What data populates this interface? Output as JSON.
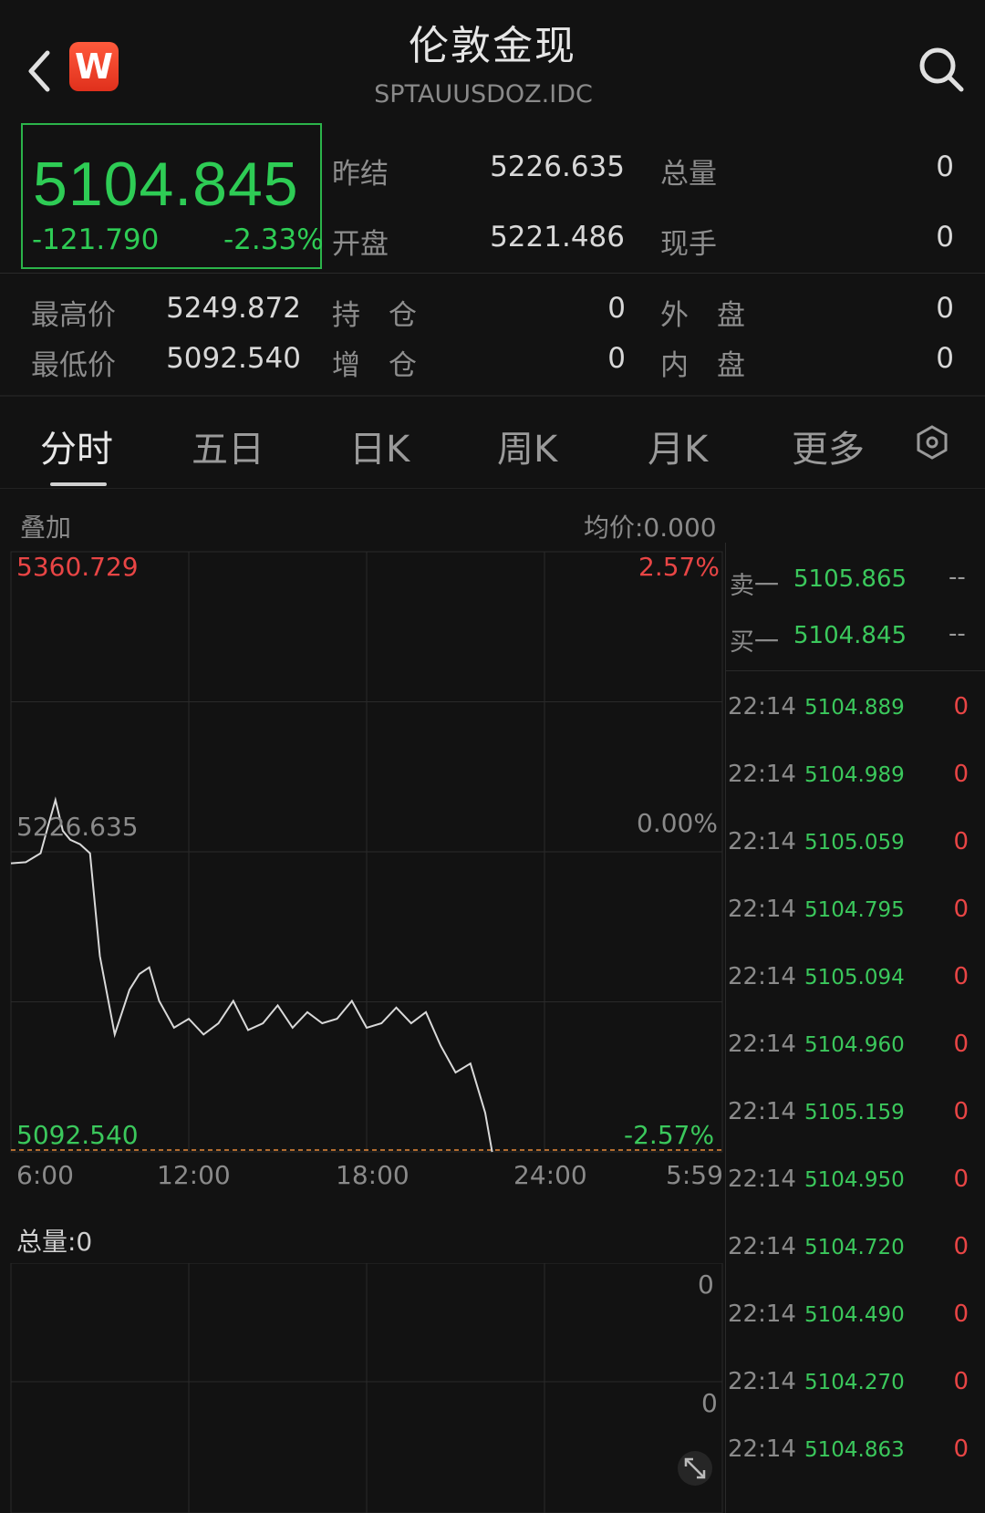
{
  "header": {
    "title": "伦敦金现",
    "symbol": "SPTAUUSDOZ.IDC",
    "logo_letter": "W"
  },
  "quote": {
    "price": "5104.845",
    "change": "-121.790",
    "change_pct": "-2.33%",
    "stats": [
      {
        "label": "昨结",
        "value": "5226.635"
      },
      {
        "label": "总量",
        "value": "0"
      },
      {
        "label": "开盘",
        "value": "5221.486"
      },
      {
        "label": "现手",
        "value": "0"
      },
      {
        "label": "最高价",
        "value": "5249.872"
      },
      {
        "label": "持　仓",
        "value": "0"
      },
      {
        "label": "外　盘",
        "value": "0"
      },
      {
        "label": "最低价",
        "value": "5092.540"
      },
      {
        "label": "增　仓",
        "value": "0"
      },
      {
        "label": "内　盘",
        "value": "0"
      }
    ]
  },
  "tabs": [
    "分时",
    "五日",
    "日K",
    "周K",
    "月K",
    "更多"
  ],
  "active_tab": "分时",
  "chart": {
    "overlay_label": "叠加",
    "avg_price_label": "均价:0.000",
    "y_top": "5360.729",
    "y_mid": "5226.635",
    "y_bottom": "5092.540",
    "pct_top": "2.57%",
    "pct_mid": "0.00%",
    "pct_bottom": "-2.57%",
    "x_labels": [
      "6:00",
      "12:00",
      "18:00",
      "24:00",
      "5:59"
    ],
    "volume_label": "总量:0",
    "volume_ticks": [
      "0",
      "0"
    ],
    "colors": {
      "up": "#e84545",
      "down": "#3bc85c",
      "line": "#d9d9d9",
      "prev_close_line": "#e88a3a"
    }
  },
  "chart_data": {
    "type": "line",
    "title": "",
    "x": [
      "6:00",
      "6:30",
      "7:00",
      "7:15",
      "7:30",
      "7:45",
      "8:00",
      "8:20",
      "8:40",
      "9:00",
      "9:30",
      "10:00",
      "10:20",
      "10:40",
      "11:00",
      "11:30",
      "12:00",
      "12:30",
      "13:00",
      "13:30",
      "14:00",
      "14:30",
      "15:00",
      "15:30",
      "16:00",
      "16:30",
      "17:00",
      "17:30",
      "18:00",
      "18:30",
      "19:00",
      "19:30",
      "20:00",
      "20:30",
      "21:00",
      "21:30",
      "22:00",
      "22:14"
    ],
    "y": [
      5221.5,
      5222.0,
      5226.0,
      5238.0,
      5249.8,
      5236.0,
      5232.0,
      5230.0,
      5226.0,
      5180.0,
      5145.0,
      5165.0,
      5172.0,
      5175.0,
      5160.0,
      5148.0,
      5152.0,
      5145.0,
      5150.0,
      5160.0,
      5147.0,
      5150.0,
      5158.0,
      5148.0,
      5155.0,
      5150.0,
      5152.0,
      5160.0,
      5148.0,
      5150.0,
      5157.0,
      5150.0,
      5155.0,
      5140.0,
      5128.0,
      5132.0,
      5110.0,
      5092.5
    ],
    "ylim": [
      5092.54,
      5360.729
    ],
    "reference": 5226.635,
    "xlabel": "",
    "ylabel": "",
    "grid": true
  },
  "orderbook": [
    {
      "label": "卖一",
      "price": "5105.865",
      "qty": "--"
    },
    {
      "label": "买一",
      "price": "5104.845",
      "qty": "--"
    }
  ],
  "trades": [
    {
      "time": "22:14",
      "price": "5104.889",
      "vol": "0"
    },
    {
      "time": "22:14",
      "price": "5104.989",
      "vol": "0"
    },
    {
      "time": "22:14",
      "price": "5105.059",
      "vol": "0"
    },
    {
      "time": "22:14",
      "price": "5104.795",
      "vol": "0"
    },
    {
      "time": "22:14",
      "price": "5105.094",
      "vol": "0"
    },
    {
      "time": "22:14",
      "price": "5104.960",
      "vol": "0"
    },
    {
      "time": "22:14",
      "price": "5105.159",
      "vol": "0"
    },
    {
      "time": "22:14",
      "price": "5104.950",
      "vol": "0"
    },
    {
      "time": "22:14",
      "price": "5104.720",
      "vol": "0"
    },
    {
      "time": "22:14",
      "price": "5104.490",
      "vol": "0"
    },
    {
      "time": "22:14",
      "price": "5104.270",
      "vol": "0"
    },
    {
      "time": "22:14",
      "price": "5104.863",
      "vol": "0"
    }
  ]
}
